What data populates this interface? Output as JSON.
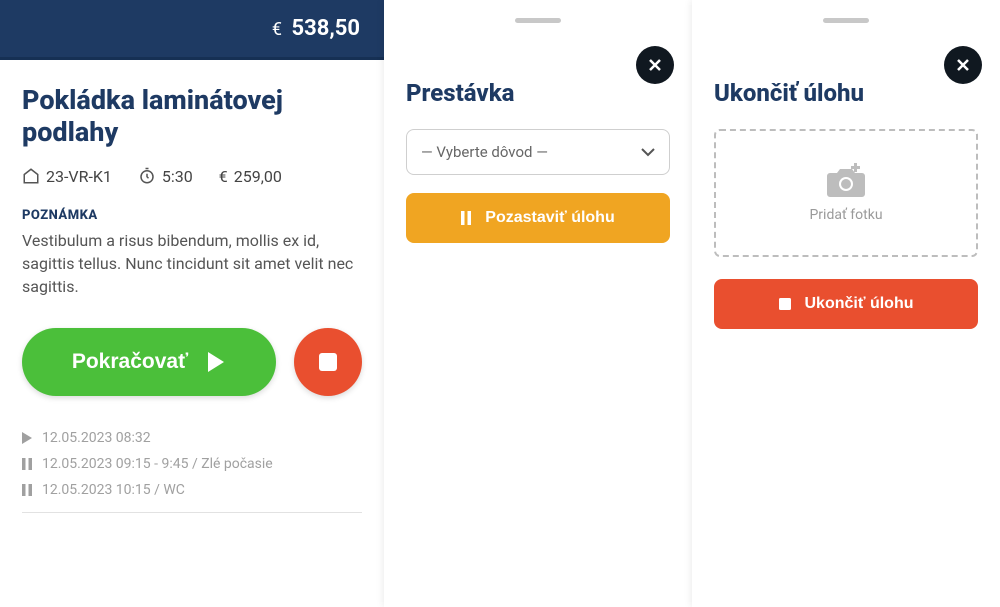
{
  "pane1": {
    "total_currency": "€",
    "total_amount": "538,50",
    "title": "Pokládka laminátovej podlahy",
    "meta": {
      "code": "23-VR-K1",
      "time": "5:30",
      "cost_currency": "€",
      "cost_amount": "259,00"
    },
    "note_label": "POZNÁMKA",
    "note_text": "Vestibulum a risus bibendum, mollis ex id, sagittis tellus. Nunc tincidunt sit amet velit nec sagittis.",
    "continue_label": "Pokračovať",
    "log": [
      {
        "icon": "play",
        "text": "12.05.2023 08:32"
      },
      {
        "icon": "pause",
        "text": "12.05.2023 09:15 - 9:45 / Zlé počasie"
      },
      {
        "icon": "pause",
        "text": "12.05.2023 10:15 / WC"
      }
    ]
  },
  "pane2": {
    "title": "Prestávka",
    "select_placeholder": "— Vyberte dôvod —",
    "pause_label": "Pozastaviť úlohu"
  },
  "pane3": {
    "title": "Ukončiť úlohu",
    "upload_label": "Pridať fotku",
    "end_label": "Ukončiť úlohu"
  }
}
